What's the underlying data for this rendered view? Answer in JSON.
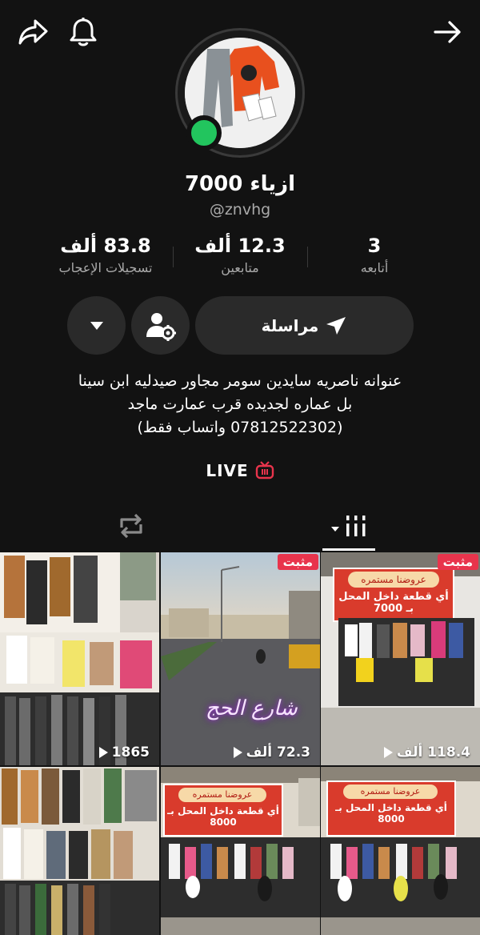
{
  "profile": {
    "name": "ازياء 7000",
    "handle": "@znvhg"
  },
  "stats": [
    {
      "value": "3",
      "label": "أتابعه"
    },
    {
      "value": "12.3 ألف",
      "label": "متابعين"
    },
    {
      "value": "83.8 ألف",
      "label": "تسجيلات الإعجاب"
    }
  ],
  "actions": {
    "message_label": "مراسلة"
  },
  "bio": {
    "line1": "عنوانه ناصريه سايدين سومر مجاور صيدليه ابن سينا",
    "line2": "بل عماره لجديده قرب عمارت ماجد",
    "line3": "(07812522302 واتساب فقط)"
  },
  "live_label": "LIVE",
  "videos": [
    {
      "views": "1865",
      "pinned": false
    },
    {
      "views": "72.3 ألف",
      "pinned": true,
      "pinned_label": "مثبت",
      "overlay_text": "شارع الحج"
    },
    {
      "views": "118.4 ألف",
      "pinned": true,
      "pinned_label": "مثبت",
      "sign_title": "عروضنا مستمره",
      "sign_text": "أي قطعة داخل المحل بـ 7000"
    },
    {
      "views": ""
    },
    {
      "sign_title": "عروضنا مستمره",
      "sign_text": "أي قطعة داخل المحل بـ 8000"
    },
    {
      "sign_title": "عروضنا مستمره",
      "sign_text": "أي قطعة داخل المحل بـ 8000"
    }
  ],
  "colors": {
    "background": "#121212",
    "pill": "#2a2a2a",
    "online": "#22c55e",
    "pinned": "#e8344c",
    "live_icon": "#e8344c"
  }
}
